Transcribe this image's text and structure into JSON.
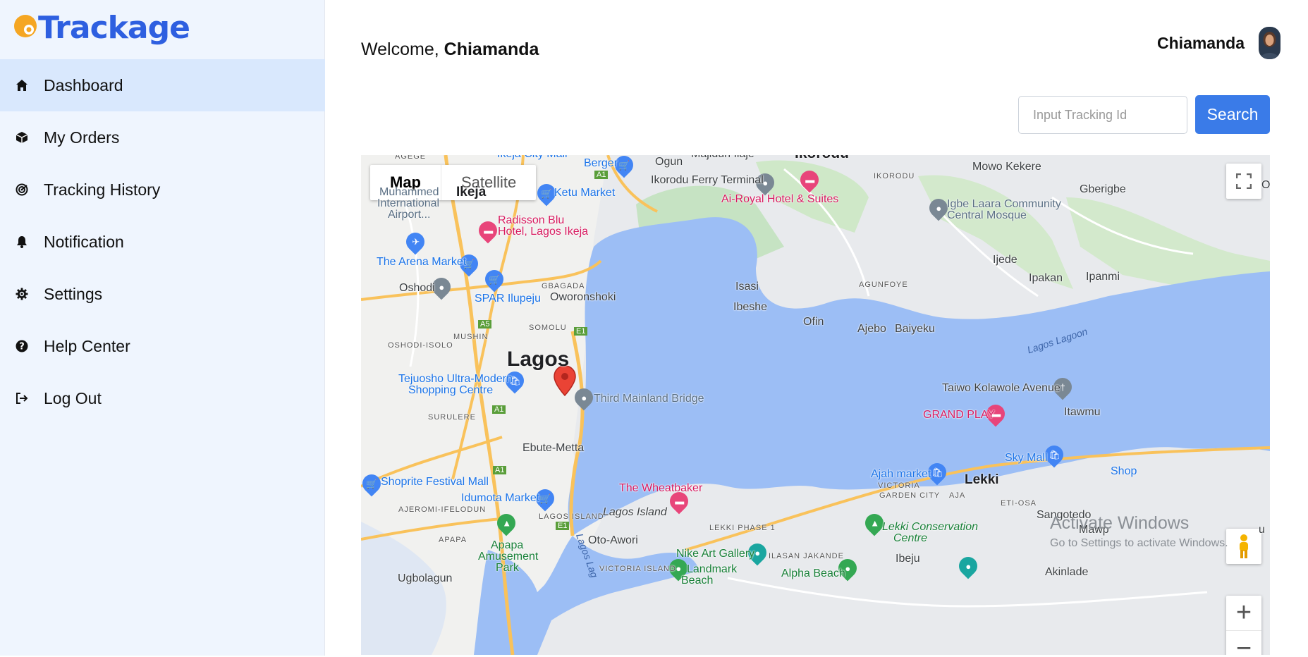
{
  "brand": {
    "name": "Trackage"
  },
  "sidebar": {
    "items": [
      {
        "label": "Dashboard",
        "icon": "home-icon",
        "active": true
      },
      {
        "label": "My Orders",
        "icon": "box-icon",
        "active": false
      },
      {
        "label": "Tracking History",
        "icon": "radar-icon",
        "active": false
      },
      {
        "label": "Notification",
        "icon": "bell-icon",
        "active": false
      },
      {
        "label": "Settings",
        "icon": "gear-icon",
        "active": false
      },
      {
        "label": "Help Center",
        "icon": "question-circle-icon",
        "active": false
      },
      {
        "label": "Log Out",
        "icon": "logout-icon",
        "active": false
      }
    ]
  },
  "header": {
    "welcome_prefix": "Welcome,",
    "welcome_name": "Chiamanda",
    "user_name": "Chiamanda"
  },
  "search": {
    "placeholder": "Input Tracking Id",
    "value": "",
    "button_label": "Search"
  },
  "map": {
    "type_controls": {
      "map": "Map",
      "satellite": "Satellite",
      "selected": "Map"
    },
    "labels": {
      "agege": "AGEGE",
      "ikeja_city_mall": "Ikeja City Mall",
      "majidun": "Majidun Ilaje",
      "ikorodu_top": "Ikorodu",
      "berger": "Berger",
      "ogun": "Ogun",
      "ikorodu_ferry": "Ikorodu Ferry Terminal",
      "ikorodu_small": "IKORODU",
      "mowo_kekere": "Mowo Kekere",
      "ikeja": "Ikeja",
      "ketu_market": "Ketu Market",
      "ai_royal": "Ai-Royal Hotel & Suites",
      "gberigbe": "Gberigbe",
      "murtala_1": "Muhammed",
      "murtala_2": "International",
      "murtala_3": "Airport...",
      "radisson_1": "Radisson Blu",
      "radisson_2": "Hotel, Lagos Ikeja",
      "igbe_1": "Igbe Laara Community",
      "igbe_2": "Central Mosque",
      "arena_market": "The Arena Market",
      "ijede": "Ijede",
      "ipakan": "Ipakan",
      "ipanmi": "Ipanmi",
      "oshodi": "Oshodi",
      "gbagada": "GBAGADA",
      "agunfoye": "AGUNFOYE",
      "isasi": "Isasi",
      "owolonshoki": "Oworonshoki",
      "spar": "SPAR Ilupeju",
      "ibeshe": "Ibeshe",
      "ofin": "Ofin",
      "somolu": "SOMOLU",
      "mushin": "MUSHIN",
      "ajebo": "Ajebo",
      "baiyeku": "Baiyeku",
      "lagos_lagoon": "Lagos Lagoon",
      "oshodi_isolo": "OSHODI-ISOLO",
      "lagos": "Lagos",
      "tejuosho_1": "Tejuosho Ultra-Modern",
      "tejuosho_2": "Shopping Centre",
      "third_mainland": "Third Mainland Bridge",
      "taiwo": "Taiwo Kolawole Avenue",
      "grand_play": "GRAND PLAY",
      "itawmu": "Itawmu",
      "surulere": "SURULERE",
      "ebute_metta": "Ebute-Metta",
      "sky_mall": "Sky Mall",
      "shoprite": "Shoprite Festival Mall",
      "ajah_market": "Ajah market",
      "lekki": "Lekki",
      "victoria_garden_1": "VICTORIA",
      "victoria_garden_2": "GARDEN CITY",
      "aja": "AJA",
      "idumota": "Idumota Market",
      "wheatbaker": "The Wheatbaker",
      "eti_osa": "ETI-OSA",
      "ajeromi": "AJEROMI-IFELODUN",
      "lagos_island_small": "LAGOS ISLAND",
      "lagos_island": "Lagos Island",
      "sangotedo": "Sangotedo",
      "lekki_phase": "LEKKI PHASE 1",
      "lekki_conservation_1": "Lekki Conservation",
      "lekki_conservation_2": "Centre",
      "mawp": "Mawp",
      "apapa": "APAPA",
      "oto_awori": "Oto-Awori",
      "apapa_park_1": "Apapa",
      "apapa_park_2": "Amusement",
      "apapa_park_3": "Park",
      "nike_art": "Nike Art Gallery",
      "ilasan": "ILASAN JAKANDE",
      "ibeju": "Ibeju",
      "victoria_island": "VICTORIA ISLAND",
      "landmark": "Landmark",
      "alpha_beach": "Alpha Beach",
      "akinlade": "Akinlade",
      "lagos_lagoon_river": "Lagos Lag",
      "ikeja_small_o": "O",
      "shop_cut": "Shop",
      "ugbolagun": "Ugbolagun",
      "beach_cut": "Beach",
      "lekki_cut": "u"
    },
    "road_shields": [
      "A1",
      "A5",
      "E1",
      "A1",
      "A1",
      "E1"
    ],
    "zoom_in": "+",
    "zoom_out": "−"
  },
  "watermark": {
    "line1": "Activate Windows",
    "line2": "Go to Settings to activate Windows."
  },
  "colors": {
    "brand_blue": "#2e5fe0",
    "brand_orange": "#f5a623",
    "sidebar_bg": "#eff5fe",
    "active_bg": "#d9e8fd",
    "button_blue": "#3a7be8",
    "water": "#9cbef5",
    "marker_red": "#ea4335"
  }
}
